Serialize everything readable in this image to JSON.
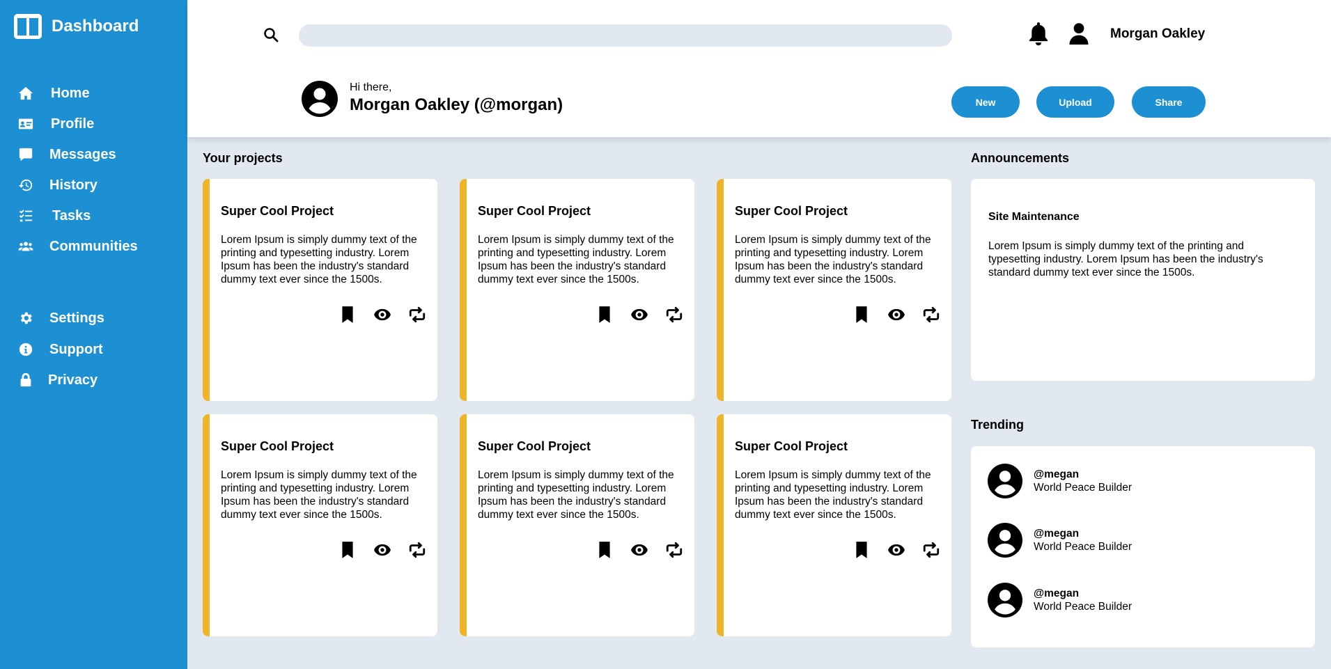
{
  "app": {
    "title": "Dashboard"
  },
  "sidebar": {
    "items": [
      {
        "label": "Home",
        "icon": "home-icon"
      },
      {
        "label": "Profile",
        "icon": "id-card-icon"
      },
      {
        "label": "Messages",
        "icon": "chat-bubble-icon"
      },
      {
        "label": "History",
        "icon": "history-icon"
      },
      {
        "label": "Tasks",
        "icon": "task-list-icon"
      },
      {
        "label": "Communities",
        "icon": "users-icon"
      },
      {
        "label": "Settings",
        "icon": "gear-icon"
      },
      {
        "label": "Support",
        "icon": "info-icon"
      },
      {
        "label": "Privacy",
        "icon": "lock-icon"
      }
    ]
  },
  "header": {
    "search": {
      "value": "",
      "placeholder": ""
    },
    "username": "Morgan Oakley",
    "greeting": "Hi there,",
    "fullname": "Morgan Oakley (@morgan)",
    "buttons": {
      "new": "New",
      "upload": "Upload",
      "share": "Share"
    }
  },
  "projects": {
    "title": "Your projects",
    "cards": [
      {
        "title": "Super Cool Project",
        "description": "Lorem Ipsum is simply dummy text of the printing and typesetting industry. Lorem Ipsum has been the industry's standard dummy text ever since the 1500s."
      },
      {
        "title": "Super Cool Project",
        "description": "Lorem Ipsum is simply dummy text of the printing and typesetting industry. Lorem Ipsum has been the industry's standard dummy text ever since the 1500s."
      },
      {
        "title": "Super Cool Project",
        "description": "Lorem Ipsum is simply dummy text of the printing and typesetting industry. Lorem Ipsum has been the industry's standard dummy text ever since the 1500s."
      },
      {
        "title": "Super Cool Project",
        "description": "Lorem Ipsum is simply dummy text of the printing and typesetting industry. Lorem Ipsum has been the industry's standard dummy text ever since the 1500s."
      },
      {
        "title": "Super Cool Project",
        "description": "Lorem Ipsum is simply dummy text of the printing and typesetting industry. Lorem Ipsum has been the industry's standard dummy text ever since the 1500s."
      },
      {
        "title": "Super Cool Project",
        "description": "Lorem Ipsum is simply dummy text of the printing and typesetting industry. Lorem Ipsum has been the industry's standard dummy text ever since the 1500s."
      }
    ]
  },
  "announcements": {
    "title": "Announcements",
    "item": {
      "title": "Site Maintenance",
      "text": "Lorem Ipsum is simply dummy text of the printing and typesetting industry. Lorem Ipsum has been the industry's standard dummy text ever since the 1500s."
    }
  },
  "trending": {
    "title": "Trending",
    "items": [
      {
        "handle": "@megan",
        "description": "World Peace Builder"
      },
      {
        "handle": "@megan",
        "description": "World Peace Builder"
      },
      {
        "handle": "@megan",
        "description": "World Peace Builder"
      }
    ]
  },
  "colors": {
    "primary": "#1d90d4",
    "accent": "#f0b429",
    "background": "#e2e8f0",
    "surface": "#ffffff",
    "text": "#000000"
  }
}
